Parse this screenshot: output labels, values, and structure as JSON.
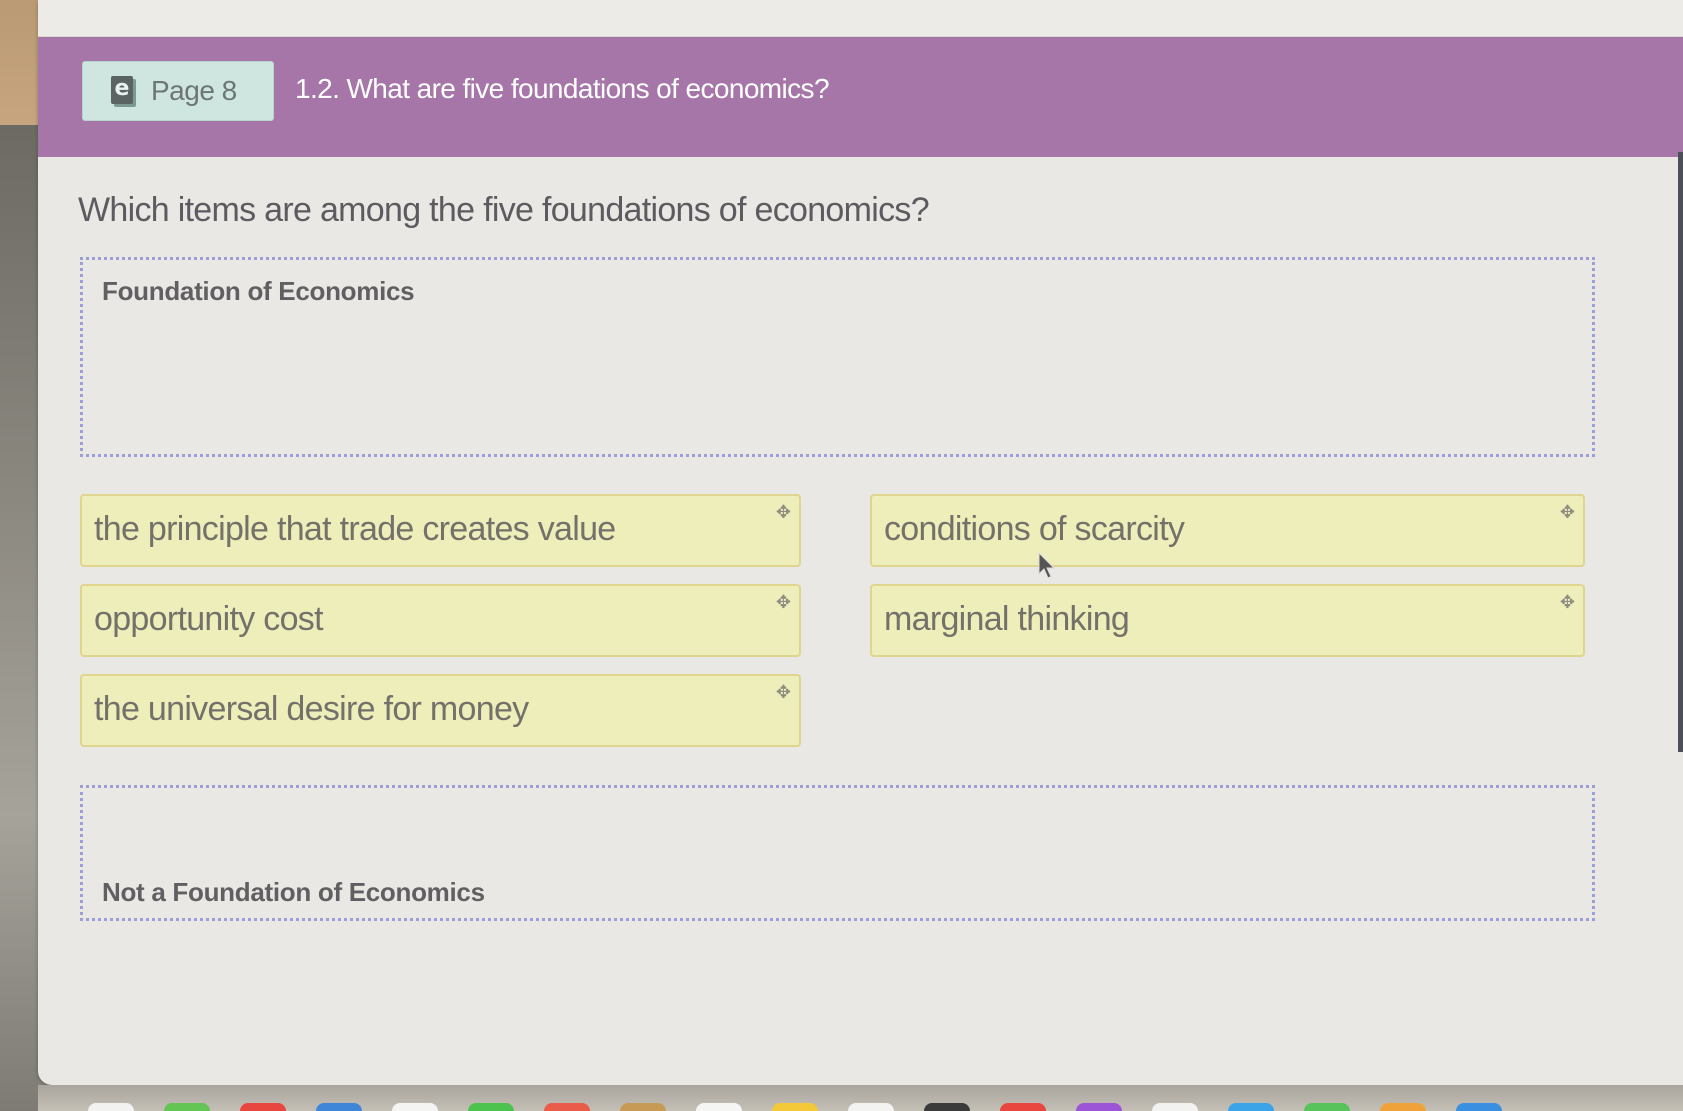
{
  "header": {
    "page_badge": {
      "icon": "ebook-icon",
      "icon_glyph": "e",
      "label": "Page 8"
    },
    "title": "1.2. What are five foundations of economics?",
    "accent_color": "#a676a9"
  },
  "question": {
    "prompt": "Which items are among the five foundations of economics?"
  },
  "dropzones": {
    "foundation": {
      "label": "Foundation of Economics",
      "items": []
    },
    "not_foundation": {
      "label": "Not a Foundation of Economics",
      "items": []
    }
  },
  "answer_bank": {
    "drag_icon": "move-icon",
    "drag_glyph": "✥",
    "tiles": [
      {
        "label": "the principle that trade creates value"
      },
      {
        "label": "conditions of scarcity"
      },
      {
        "label": "opportunity cost"
      },
      {
        "label": "marginal thinking"
      },
      {
        "label": "the universal desire for money"
      }
    ],
    "tile_color": "#eeeeba"
  },
  "dock": {
    "app_colors": [
      "#f2f2f0",
      "#62c554",
      "#e8473f",
      "#3f86d8",
      "#f4f4f2",
      "#4cc24f",
      "#ea5b49",
      "#c79a55",
      "#f5f5f3",
      "#f3c93a",
      "#f3f3f1",
      "#3b3b3b",
      "#e8463e",
      "#9c55d6",
      "#f2f2f0",
      "#3ba4e8",
      "#58c35a",
      "#f0a23a",
      "#3b8fe0"
    ]
  }
}
